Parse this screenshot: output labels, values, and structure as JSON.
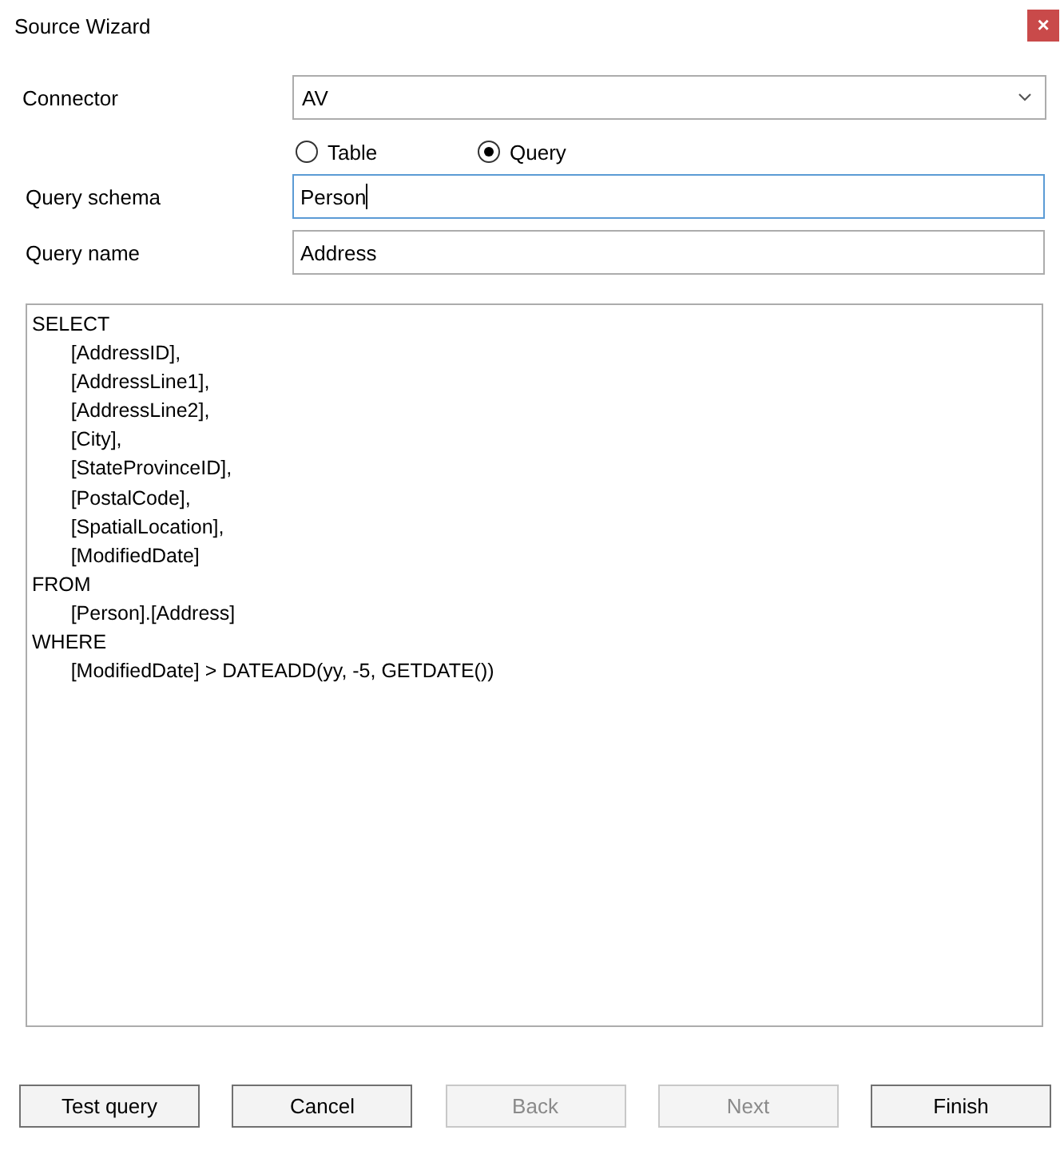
{
  "window": {
    "title": "Source Wizard",
    "close": "×"
  },
  "connector": {
    "label": "Connector",
    "value": "AV"
  },
  "source_type": [
    {
      "label": "Table",
      "selected": false
    },
    {
      "label": "Query",
      "selected": true
    }
  ],
  "fields": [
    {
      "label": "Query schema",
      "value": "Person",
      "focused": true
    },
    {
      "label": "Query name",
      "value": "Address",
      "focused": false
    }
  ],
  "query": "SELECT\n\t[AddressID],\n\t[AddressLine1],\n\t[AddressLine2],\n\t[City],\n\t[StateProvinceID],\n\t[PostalCode],\n\t[SpatialLocation],\n\t[ModifiedDate]\nFROM\n\t[Person].[Address]\nWHERE\n\t[ModifiedDate] > DATEADD(yy, -5, GETDATE())",
  "buttons": [
    {
      "label": "Test query",
      "disabled": false
    },
    {
      "label": "Cancel",
      "disabled": false
    },
    {
      "label": "Back",
      "disabled": true
    },
    {
      "label": "Next",
      "disabled": true
    },
    {
      "label": "Finish",
      "disabled": false
    }
  ]
}
